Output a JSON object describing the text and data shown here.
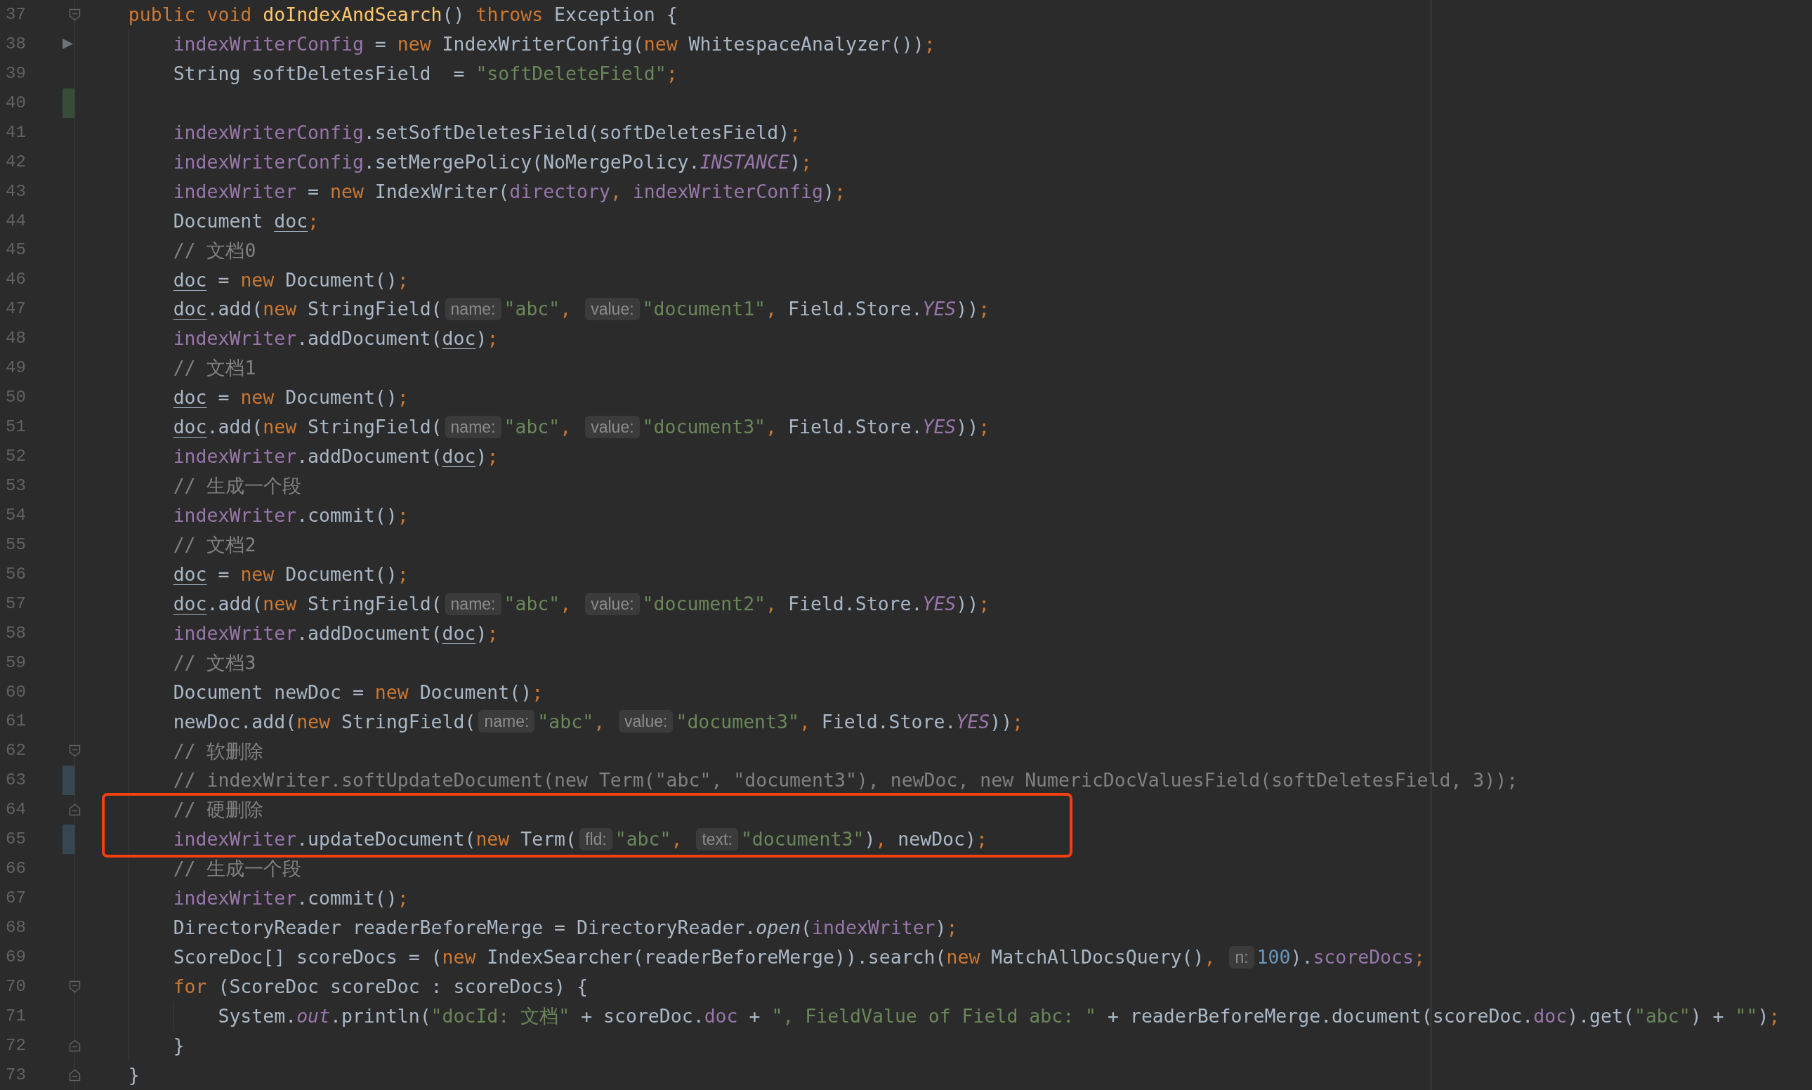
{
  "editor": {
    "lines": [
      {
        "number": "37",
        "kind": "method",
        "markers": [
          {
            "kind": "fold_start"
          }
        ],
        "tokens": [
          {
            "kind": "kw",
            "text": "public void "
          },
          {
            "kind": "method_decl",
            "text": "doIndexAndSearch"
          },
          {
            "kind": "plain",
            "text": "() "
          },
          {
            "kind": "kw",
            "text": "throws "
          },
          {
            "kind": "plain",
            "text": "Exception {"
          }
        ]
      },
      {
        "number": "38",
        "kind": "body",
        "markers": [
          {
            "kind": "run"
          }
        ],
        "tokens": [
          {
            "kind": "field",
            "text": "indexWriterConfig"
          },
          {
            "kind": "plain",
            "text": " = "
          },
          {
            "kind": "kw",
            "text": "new "
          },
          {
            "kind": "plain",
            "text": "IndexWriterConfig("
          },
          {
            "kind": "kw",
            "text": "new "
          },
          {
            "kind": "plain",
            "text": "WhitespaceAnalyzer())"
          },
          {
            "kind": "punct",
            "text": ";"
          }
        ]
      },
      {
        "number": "39",
        "kind": "body",
        "tokens": [
          {
            "kind": "plain",
            "text": "String softDeletesField  = "
          },
          {
            "kind": "str",
            "text": "\"softDeleteField\""
          },
          {
            "kind": "punct",
            "text": ";"
          }
        ]
      },
      {
        "number": "40",
        "kind": "body",
        "markers": [
          {
            "kind": "added"
          }
        ]
      },
      {
        "number": "41",
        "kind": "body",
        "tokens": [
          {
            "kind": "field",
            "text": "indexWriterConfig"
          },
          {
            "kind": "plain",
            "text": ".setSoftDeletesField(softDeletesField)"
          },
          {
            "kind": "punct",
            "text": ";"
          }
        ]
      },
      {
        "number": "42",
        "kind": "body",
        "tokens": [
          {
            "kind": "field",
            "text": "indexWriterConfig"
          },
          {
            "kind": "plain",
            "text": ".setMergePolicy(NoMergePolicy."
          },
          {
            "kind": "static",
            "text": "INSTANCE"
          },
          {
            "kind": "plain",
            "text": ")"
          },
          {
            "kind": "punct",
            "text": ";"
          }
        ]
      },
      {
        "number": "43",
        "kind": "body",
        "tokens": [
          {
            "kind": "field",
            "text": "indexWriter"
          },
          {
            "kind": "plain",
            "text": " = "
          },
          {
            "kind": "kw",
            "text": "new "
          },
          {
            "kind": "plain",
            "text": "IndexWriter("
          },
          {
            "kind": "field",
            "text": "directory"
          },
          {
            "kind": "punct",
            "text": ", "
          },
          {
            "kind": "field",
            "text": "indexWriterConfig"
          },
          {
            "kind": "plain",
            "text": ")"
          },
          {
            "kind": "punct",
            "text": ";"
          }
        ]
      },
      {
        "number": "44",
        "kind": "body",
        "tokens": [
          {
            "kind": "plain",
            "text": "Document "
          },
          {
            "kind": "reassigned",
            "text": "doc"
          },
          {
            "kind": "punct",
            "text": ";"
          }
        ]
      },
      {
        "number": "45",
        "kind": "body",
        "tokens": [
          {
            "kind": "comment",
            "text": "// 文档0"
          }
        ]
      },
      {
        "number": "46",
        "kind": "body",
        "tokens": [
          {
            "kind": "reassigned",
            "text": "doc"
          },
          {
            "kind": "plain",
            "text": " = "
          },
          {
            "kind": "kw",
            "text": "new "
          },
          {
            "kind": "plain",
            "text": "Document()"
          },
          {
            "kind": "punct",
            "text": ";"
          }
        ]
      },
      {
        "number": "47",
        "kind": "body",
        "tokens": [
          {
            "kind": "reassigned",
            "text": "doc"
          },
          {
            "kind": "plain",
            "text": ".add("
          },
          {
            "kind": "kw",
            "text": "new "
          },
          {
            "kind": "plain",
            "text": "StringField("
          },
          {
            "kind": "hint",
            "text": "name:"
          },
          {
            "kind": "str",
            "text": "\"abc\""
          },
          {
            "kind": "punct",
            "text": ", "
          },
          {
            "kind": "hint",
            "text": "value:"
          },
          {
            "kind": "str",
            "text": "\"document1\""
          },
          {
            "kind": "punct",
            "text": ", "
          },
          {
            "kind": "plain",
            "text": "Field.Store."
          },
          {
            "kind": "static",
            "text": "YES"
          },
          {
            "kind": "plain",
            "text": "))"
          },
          {
            "kind": "punct",
            "text": ";"
          }
        ]
      },
      {
        "number": "48",
        "kind": "body",
        "tokens": [
          {
            "kind": "field",
            "text": "indexWriter"
          },
          {
            "kind": "plain",
            "text": ".addDocument("
          },
          {
            "kind": "reassigned",
            "text": "doc"
          },
          {
            "kind": "plain",
            "text": ")"
          },
          {
            "kind": "punct",
            "text": ";"
          }
        ]
      },
      {
        "number": "49",
        "kind": "body",
        "tokens": [
          {
            "kind": "comment",
            "text": "// 文档1"
          }
        ]
      },
      {
        "number": "50",
        "kind": "body",
        "tokens": [
          {
            "kind": "reassigned",
            "text": "doc"
          },
          {
            "kind": "plain",
            "text": " = "
          },
          {
            "kind": "kw",
            "text": "new "
          },
          {
            "kind": "plain",
            "text": "Document()"
          },
          {
            "kind": "punct",
            "text": ";"
          }
        ]
      },
      {
        "number": "51",
        "kind": "body",
        "tokens": [
          {
            "kind": "reassigned",
            "text": "doc"
          },
          {
            "kind": "plain",
            "text": ".add("
          },
          {
            "kind": "kw",
            "text": "new "
          },
          {
            "kind": "plain",
            "text": "StringField("
          },
          {
            "kind": "hint",
            "text": "name:"
          },
          {
            "kind": "str",
            "text": "\"abc\""
          },
          {
            "kind": "punct",
            "text": ", "
          },
          {
            "kind": "hint",
            "text": "value:"
          },
          {
            "kind": "str",
            "text": "\"document3\""
          },
          {
            "kind": "punct",
            "text": ", "
          },
          {
            "kind": "plain",
            "text": "Field.Store."
          },
          {
            "kind": "static",
            "text": "YES"
          },
          {
            "kind": "plain",
            "text": "))"
          },
          {
            "kind": "punct",
            "text": ";"
          }
        ]
      },
      {
        "number": "52",
        "kind": "body",
        "tokens": [
          {
            "kind": "field",
            "text": "indexWriter"
          },
          {
            "kind": "plain",
            "text": ".addDocument("
          },
          {
            "kind": "reassigned",
            "text": "doc"
          },
          {
            "kind": "plain",
            "text": ")"
          },
          {
            "kind": "punct",
            "text": ";"
          }
        ]
      },
      {
        "number": "53",
        "kind": "body",
        "tokens": [
          {
            "kind": "comment",
            "text": "// 生成一个段"
          }
        ]
      },
      {
        "number": "54",
        "kind": "body",
        "tokens": [
          {
            "kind": "field",
            "text": "indexWriter"
          },
          {
            "kind": "plain",
            "text": ".commit()"
          },
          {
            "kind": "punct",
            "text": ";"
          }
        ]
      },
      {
        "number": "55",
        "kind": "body",
        "tokens": [
          {
            "kind": "comment",
            "text": "// 文档2"
          }
        ]
      },
      {
        "number": "56",
        "kind": "body",
        "tokens": [
          {
            "kind": "reassigned",
            "text": "doc"
          },
          {
            "kind": "plain",
            "text": " = "
          },
          {
            "kind": "kw",
            "text": "new "
          },
          {
            "kind": "plain",
            "text": "Document()"
          },
          {
            "kind": "punct",
            "text": ";"
          }
        ]
      },
      {
        "number": "57",
        "kind": "body",
        "tokens": [
          {
            "kind": "reassigned",
            "text": "doc"
          },
          {
            "kind": "plain",
            "text": ".add("
          },
          {
            "kind": "kw",
            "text": "new "
          },
          {
            "kind": "plain",
            "text": "StringField("
          },
          {
            "kind": "hint",
            "text": "name:"
          },
          {
            "kind": "str",
            "text": "\"abc\""
          },
          {
            "kind": "punct",
            "text": ", "
          },
          {
            "kind": "hint",
            "text": "value:"
          },
          {
            "kind": "str",
            "text": "\"document2\""
          },
          {
            "kind": "punct",
            "text": ", "
          },
          {
            "kind": "plain",
            "text": "Field.Store."
          },
          {
            "kind": "static",
            "text": "YES"
          },
          {
            "kind": "plain",
            "text": "))"
          },
          {
            "kind": "punct",
            "text": ";"
          }
        ]
      },
      {
        "number": "58",
        "kind": "body",
        "tokens": [
          {
            "kind": "field",
            "text": "indexWriter"
          },
          {
            "kind": "plain",
            "text": ".addDocument("
          },
          {
            "kind": "reassigned",
            "text": "doc"
          },
          {
            "kind": "plain",
            "text": ")"
          },
          {
            "kind": "punct",
            "text": ";"
          }
        ]
      },
      {
        "number": "59",
        "kind": "body",
        "tokens": [
          {
            "kind": "comment",
            "text": "// 文档3"
          }
        ]
      },
      {
        "number": "60",
        "kind": "body",
        "tokens": [
          {
            "kind": "plain",
            "text": "Document newDoc = "
          },
          {
            "kind": "kw",
            "text": "new "
          },
          {
            "kind": "plain",
            "text": "Document()"
          },
          {
            "kind": "punct",
            "text": ";"
          }
        ]
      },
      {
        "number": "61",
        "kind": "body",
        "tokens": [
          {
            "kind": "plain",
            "text": "newDoc.add("
          },
          {
            "kind": "kw",
            "text": "new "
          },
          {
            "kind": "plain",
            "text": "StringField("
          },
          {
            "kind": "hint",
            "text": "name:"
          },
          {
            "kind": "str",
            "text": "\"abc\""
          },
          {
            "kind": "punct",
            "text": ", "
          },
          {
            "kind": "hint",
            "text": "value:"
          },
          {
            "kind": "str",
            "text": "\"document3\""
          },
          {
            "kind": "punct",
            "text": ", "
          },
          {
            "kind": "plain",
            "text": "Field.Store."
          },
          {
            "kind": "static",
            "text": "YES"
          },
          {
            "kind": "plain",
            "text": "))"
          },
          {
            "kind": "punct",
            "text": ";"
          }
        ]
      },
      {
        "number": "62",
        "kind": "body",
        "markers": [
          {
            "kind": "fold_start"
          }
        ],
        "tokens": [
          {
            "kind": "comment",
            "text": "// 软删除"
          }
        ]
      },
      {
        "number": "63",
        "kind": "body",
        "markers": [
          {
            "kind": "modified"
          }
        ],
        "tokens": [
          {
            "kind": "comment",
            "text": "// indexWriter.softUpdateDocument(new Term(\"abc\", \"document3\"), newDoc, new NumericDocValuesField(softDeletesField, 3));"
          }
        ]
      },
      {
        "number": "64",
        "kind": "body",
        "boxed": true,
        "markers": [
          {
            "kind": "fold_end"
          }
        ],
        "tokens": [
          {
            "kind": "comment",
            "text": "// 硬删除"
          }
        ]
      },
      {
        "number": "65",
        "kind": "body",
        "boxed": true,
        "markers": [
          {
            "kind": "modified"
          }
        ],
        "tokens": [
          {
            "kind": "field",
            "text": "indexWriter"
          },
          {
            "kind": "plain",
            "text": ".updateDocument("
          },
          {
            "kind": "kw",
            "text": "new "
          },
          {
            "kind": "plain",
            "text": "Term("
          },
          {
            "kind": "hint",
            "text": "fld:"
          },
          {
            "kind": "str",
            "text": "\"abc\""
          },
          {
            "kind": "punct",
            "text": ", "
          },
          {
            "kind": "hint",
            "text": "text:"
          },
          {
            "kind": "str",
            "text": "\"document3\""
          },
          {
            "kind": "plain",
            "text": ")"
          },
          {
            "kind": "punct",
            "text": ", "
          },
          {
            "kind": "plain",
            "text": "newDoc)"
          },
          {
            "kind": "punct",
            "text": ";"
          }
        ]
      },
      {
        "number": "66",
        "kind": "body",
        "tokens": [
          {
            "kind": "comment",
            "text": "// 生成一个段"
          }
        ]
      },
      {
        "number": "67",
        "kind": "body",
        "tokens": [
          {
            "kind": "field",
            "text": "indexWriter"
          },
          {
            "kind": "plain",
            "text": ".commit()"
          },
          {
            "kind": "punct",
            "text": ";"
          }
        ]
      },
      {
        "number": "68",
        "kind": "body",
        "tokens": [
          {
            "kind": "plain",
            "text": "DirectoryReader readerBeforeMerge = DirectoryReader."
          },
          {
            "kind": "static_method",
            "text": "open"
          },
          {
            "kind": "plain",
            "text": "("
          },
          {
            "kind": "field",
            "text": "indexWriter"
          },
          {
            "kind": "plain",
            "text": ")"
          },
          {
            "kind": "punct",
            "text": ";"
          }
        ]
      },
      {
        "number": "69",
        "kind": "body",
        "tokens": [
          {
            "kind": "plain",
            "text": "ScoreDoc[] scoreDocs = ("
          },
          {
            "kind": "kw",
            "text": "new "
          },
          {
            "kind": "plain",
            "text": "IndexSearcher(readerBeforeMerge)).search("
          },
          {
            "kind": "kw",
            "text": "new "
          },
          {
            "kind": "plain",
            "text": "MatchAllDocsQuery()"
          },
          {
            "kind": "punct",
            "text": ", "
          },
          {
            "kind": "hint",
            "text": "n:"
          },
          {
            "kind": "num",
            "text": "100"
          },
          {
            "kind": "plain",
            "text": ")."
          },
          {
            "kind": "field",
            "text": "scoreDocs"
          },
          {
            "kind": "punct",
            "text": ";"
          }
        ]
      },
      {
        "number": "70",
        "kind": "body",
        "markers": [
          {
            "kind": "fold_start"
          }
        ],
        "tokens": [
          {
            "kind": "kw",
            "text": "for "
          },
          {
            "kind": "plain",
            "text": "(ScoreDoc scoreDoc : scoreDocs) {"
          }
        ]
      },
      {
        "number": "71",
        "kind": "loop",
        "tokens": [
          {
            "kind": "plain",
            "text": "System."
          },
          {
            "kind": "static",
            "text": "out"
          },
          {
            "kind": "plain",
            "text": ".println("
          },
          {
            "kind": "str",
            "text": "\"docId: 文档\""
          },
          {
            "kind": "plain",
            "text": " + scoreDoc."
          },
          {
            "kind": "field",
            "text": "doc"
          },
          {
            "kind": "plain",
            "text": " + "
          },
          {
            "kind": "str",
            "text": "\", FieldValue of Field abc: \""
          },
          {
            "kind": "plain",
            "text": " + readerBeforeMerge.document(scoreDoc."
          },
          {
            "kind": "field",
            "text": "doc"
          },
          {
            "kind": "plain",
            "text": ").get("
          },
          {
            "kind": "str",
            "text": "\"abc\""
          },
          {
            "kind": "plain",
            "text": ") + "
          },
          {
            "kind": "str",
            "text": "\"\""
          },
          {
            "kind": "plain",
            "text": ")"
          },
          {
            "kind": "punct",
            "text": ";"
          }
        ]
      },
      {
        "number": "72",
        "kind": "body",
        "markers": [
          {
            "kind": "fold_end"
          }
        ],
        "tokens": [
          {
            "kind": "plain",
            "text": "}"
          }
        ]
      },
      {
        "number": "73",
        "kind": "method",
        "markers": [
          {
            "kind": "fold_end"
          }
        ],
        "tokens": [
          {
            "kind": "plain",
            "text": "}"
          }
        ]
      }
    ]
  }
}
